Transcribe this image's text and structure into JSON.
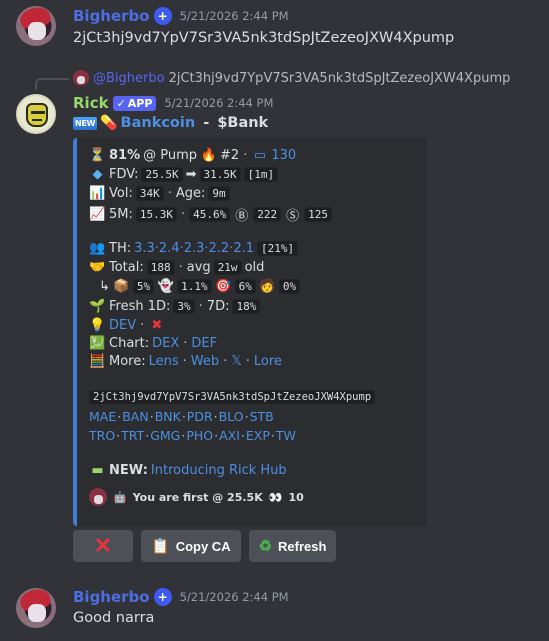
{
  "message1": {
    "username": "Bigherbo",
    "timestamp": "5/21/2026 2:44 PM",
    "text": "2jCt3hj9vd7YpV7Sr3VA5nk3tdSpJtZezeoJXW4Xpump"
  },
  "reply": {
    "username": "@Bigherbo",
    "text": "2jCt3hj9vd7YpV7Sr3VA5nk3tdSpJtZezeoJXW4Xpump"
  },
  "message2": {
    "username": "Rick",
    "app_badge": "APP",
    "timestamp": "5/21/2026 2:44 PM",
    "title_new": "NEW",
    "title_token": "Bankcoin",
    "title_dash": " - ",
    "title_ticker": "$Bank"
  },
  "embed": {
    "line1": {
      "pct": "81%",
      "at": "@ Pump",
      "rank": "#2",
      "count": "130"
    },
    "fdv": {
      "label": "FDV:",
      "from": "25.5K",
      "to": "31.5K",
      "period": "[1m]"
    },
    "vol": {
      "label": "Vol:",
      "value": "34K",
      "age_label": "Age:",
      "age": "9m"
    },
    "m5": {
      "label": "5M:",
      "value": "15.3K",
      "pct": "45.6%",
      "b_count": "222",
      "s_count": "125"
    },
    "th": {
      "label": "TH:",
      "values": "3.3·2.4·2.3·2.2·2.1",
      "total": "[21%]"
    },
    "total": {
      "label": "Total:",
      "value": "188",
      "avg_label": "avg",
      "avg": "21w",
      "suffix": "old"
    },
    "breakdown": {
      "a": "5%",
      "b": "1.1%",
      "c": "6%",
      "d": "0%"
    },
    "fresh": {
      "label": "Fresh 1D:",
      "d1": "3%",
      "label7": "7D:",
      "d7": "18%"
    },
    "dev": {
      "label": "DEV"
    },
    "chart": {
      "label": "Chart:",
      "dex": "DEX",
      "def": "DEF"
    },
    "more": {
      "label": "More:",
      "lens": "Lens",
      "web": "Web",
      "x": "𝕏",
      "lore": "Lore"
    },
    "ca": "2jCt3hj9vd7YpV7Sr3VA5nk3tdSpJtZezeoJXW4Xpump",
    "links1": [
      "MAE",
      "BAN",
      "BNK",
      "PDR",
      "BLO",
      "STB"
    ],
    "links2": [
      "TRO",
      "TRT",
      "GMG",
      "PHO",
      "AXI",
      "EXP",
      "TW"
    ],
    "news": {
      "label": "NEW:",
      "text": "Introducing Rick Hub"
    },
    "first": {
      "text": "You are first @ 25.5K",
      "count": "10"
    }
  },
  "buttons": {
    "close": "✕",
    "copy_ca": "Copy CA",
    "refresh": "Refresh"
  },
  "message3": {
    "username": "Bigherbo",
    "timestamp": "5/21/2026 2:44 PM",
    "text": "Good narra"
  },
  "colors": {
    "accent": "#5865f2",
    "rick_name": "#9ad66b",
    "embed_bar": "#3f7fd6",
    "link": "#4d8fe0",
    "background": "#313338"
  },
  "icons": [
    "verified-badge-icon",
    "hourglass-icon",
    "fire-icon",
    "tv-icon",
    "diamond-icon",
    "chart-icon",
    "trend-icon",
    "bitcoin-icon",
    "dollar-icon",
    "users-icon",
    "handshake-icon",
    "box-icon",
    "ghost-icon",
    "target-icon",
    "teacher-icon",
    "seedling-icon",
    "bulb-icon",
    "cross-icon",
    "chart-yen-icon",
    "abacus-icon",
    "card-icon",
    "robot-icon",
    "reload-icon"
  ]
}
